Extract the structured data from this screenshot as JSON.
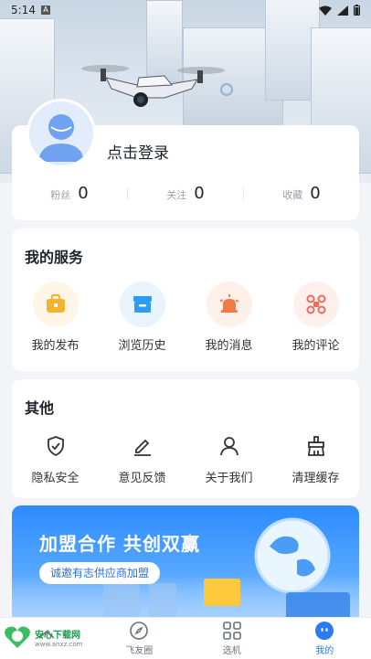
{
  "status_bar": {
    "time": "5:14",
    "sim_badge": "A"
  },
  "profile": {
    "login_prompt": "点击登录",
    "stats": [
      {
        "label": "粉丝",
        "value": "0"
      },
      {
        "label": "关注",
        "value": "0"
      },
      {
        "label": "收藏",
        "value": "0"
      }
    ]
  },
  "services": {
    "title": "我的服务",
    "items": [
      {
        "label": "我的发布",
        "icon": "briefcase-icon",
        "color": "#f5b32d",
        "bg": "#fff6e8"
      },
      {
        "label": "浏览历史",
        "icon": "archive-box-icon",
        "color": "#2f9cf4",
        "bg": "#e8f4fe"
      },
      {
        "label": "我的消息",
        "icon": "alarm-light-icon",
        "color": "#f27a45",
        "bg": "#fff0ea"
      },
      {
        "label": "我的评论",
        "icon": "drone-icon",
        "color": "#ee6a5a",
        "bg": "#fff0ee"
      }
    ]
  },
  "others": {
    "title": "其他",
    "items": [
      {
        "label": "隐私安全",
        "icon": "shield-check-icon"
      },
      {
        "label": "意见反馈",
        "icon": "pencil-icon"
      },
      {
        "label": "关于我们",
        "icon": "person-icon"
      },
      {
        "label": "清理缓存",
        "icon": "cleaning-icon"
      }
    ]
  },
  "banner": {
    "title": "加盟合作 共创双赢",
    "button": "诚邀有志供应商加盟"
  },
  "bottom_nav": {
    "items": [
      {
        "label": "",
        "icon": "home-icon"
      },
      {
        "label": "飞友圈",
        "icon": "compass-icon"
      },
      {
        "label": "选机",
        "icon": "grid-icon"
      },
      {
        "label": "我的",
        "icon": "profile-face-icon",
        "active": true
      }
    ]
  },
  "watermark": {
    "text1": "安心下载网",
    "text2": "www.anxz.com"
  }
}
